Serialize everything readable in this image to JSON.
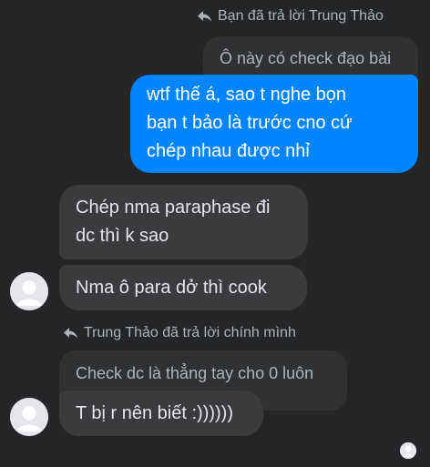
{
  "thread": {
    "reply_label_top": "Bạn đã trả lời Trung Thảo",
    "quoted_top": "Ô này có check đạo bài",
    "sent_message": [
      "wtf thế á, sao t nghe bọn",
      "bạn t bảo là trước cno cứ",
      "chép nhau được nhỉ"
    ],
    "received_1": [
      "Chép nma paraphase đi",
      "dc thì k sao"
    ],
    "received_2": "Nma ô para dở thì cook",
    "reply_label_bottom": "Trung Thảo đã trả lời chính mình",
    "quoted_bottom": "Check dc là thẳng tay cho 0 luôn",
    "received_3": "T bị r nên biết :))))))"
  },
  "colors": {
    "background": "#242526",
    "received_bubble": "#3a3b3c",
    "quoted_bubble": "#303132",
    "sent_bubble": "#0084ff",
    "text_primary": "#e4e6eb",
    "text_secondary": "#b0b3b8"
  },
  "icons": [
    "reply-arrow-icon",
    "avatar-placeholder-icon",
    "seen-avatar-icon"
  ]
}
